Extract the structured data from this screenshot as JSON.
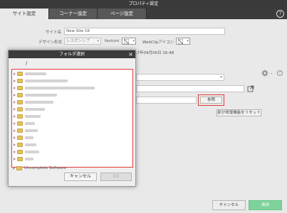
{
  "window": {
    "title": "プロパティ設定"
  },
  "tabs": [
    {
      "label": "サイト設定"
    },
    {
      "label": "コーナー設定"
    },
    {
      "label": "ページ設定"
    }
  ],
  "form": {
    "site_name_label": "サイト名",
    "site_name_value": "New Site 16",
    "design_label": "デザイン形式",
    "design_value": "レスポンシブ",
    "favicon_label": "favicon",
    "webclip_label": "WebClipアイコン",
    "date_text": "17年09月06日 16:48",
    "browse_button": "参照",
    "reset_button": "部分修復機能をリセット"
  },
  "footer": {
    "cancel": "キャンセル",
    "apply": "適用"
  },
  "folder_dialog": {
    "title": "フォルダ選択",
    "root": "/",
    "partial_item": "Uncomplete Software",
    "cancel": "キャンセル",
    "ok": "OK"
  },
  "colors": {
    "highlight_red": "#e23b3b",
    "titlebar": "#3a3a3a",
    "apply_green": "#7dd39a"
  }
}
